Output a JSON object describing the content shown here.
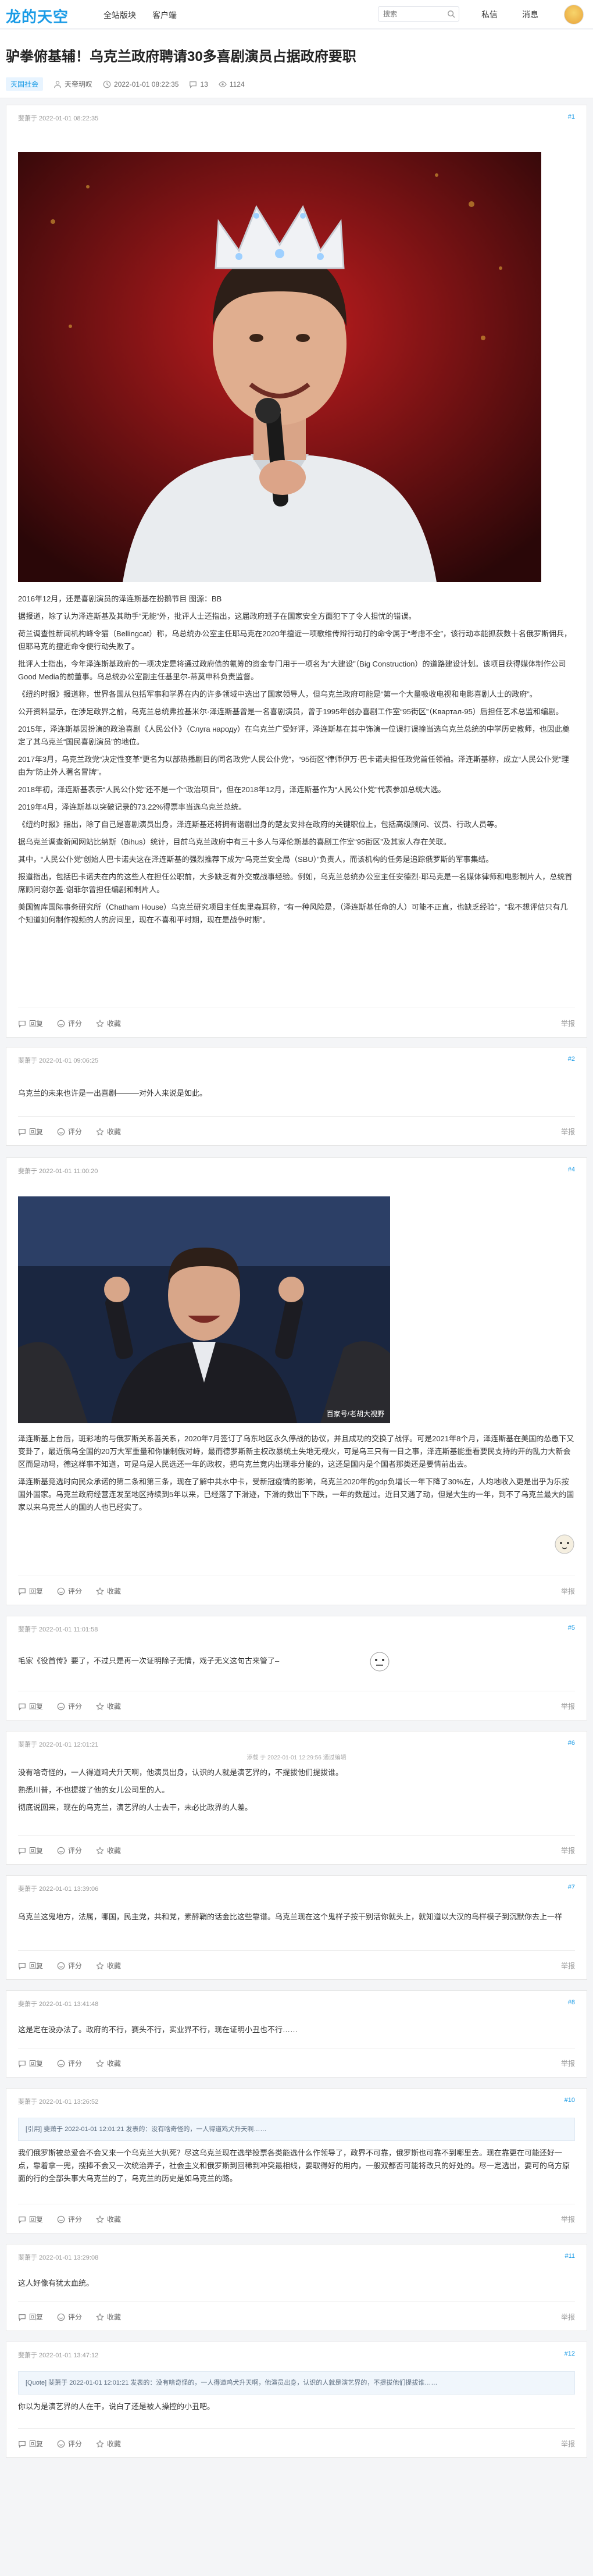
{
  "site": {
    "logo": "龙的天空",
    "nav": [
      "全站版块",
      "客户端"
    ],
    "search_placeholder": "搜索",
    "right": [
      "私信",
      "消息"
    ]
  },
  "article": {
    "title": "驴拳俯基辅！乌克兰政府聘请30多喜剧演员占据政府要职",
    "tag": "灭国社会",
    "author": "天帝玥叹",
    "time": "2022-01-01 08:22:35",
    "comments": "13",
    "views": "1124"
  },
  "labels": {
    "reply": "回复",
    "rate": "评分",
    "fav": "收藏",
    "report": "举报"
  },
  "posts": [
    {
      "author": "斐萧于 2022-01-01 08:22:35",
      "floor": "#1",
      "paras": [
        "2016年12月，还是喜剧演员的泽连斯基在扮鹅节目 图源：BB",
        "据报道，除了认为泽连斯基及其助手“无能”外，批评人士还指出，这届政府班子在国家安全方面犯下了令人担忧的错误。",
        "荷兰调查性新闻机构峰令猫（Bellingcat）称，乌总统办公室主任耶马克在2020年擅近一项歌维传辩行动打的命令属于“考虑不全”，该行动本能抓获数十名俄罗斯佣兵，但耶马克的擅近命令使行动失败了。",
        "批评人士指出，今年泽连斯基政府的一项决定是将通过政府债的氰筹的资金专门用于一项名为“大建设”（Big Construction）的道路建设计划。该项目获得媒体制作公司Good Media的前董事。乌总统办公室副主任基里尔-蒂莫申科负责监督。",
        "《纽约时报》报道称，世界各国从包括军事和学界在内的许多领域中选出了国家领导人，但乌克兰政府可能是“第一个大量吸收电视和电影喜剧人士的政府”。",
        "公开资料显示，在涉足政界之前，乌克兰总统弗拉基米尔·泽连斯基曾是一名喜剧演员，曾于1995年创办喜剧工作室“95街区”（Kвартал-95）后担任艺术总监和编剧。",
        "2015年，泽连斯基因扮演的政治喜剧《人民公仆》（Слуга народу）在乌克兰广受好评，泽连斯基在其中饰演一位误打误撞当选乌克兰总统的中学历史教师，也因此奠定了其乌克兰“国民喜剧演员”的地位。",
        "2017年3月，乌克兰政党“决定性变革”更名为以部热播剧目的同名政党“人民公仆党”，“95街区”律师伊万·巴卡诺夫担任政党首任领袖。泽连斯基称，成立“人民公仆党”理由为“防止外人著名冒牌”。",
        "2018年初，泽连斯基表示“人民公仆党”还不是一个“政治项目”，但在2018年12月，泽连斯基作为“人民公仆党”代表参加总统大选。",
        "2019年4月，泽连斯基以突破记录的73.22%得票率当选乌克兰总统。",
        "《纽约时报》指出，除了自己是喜剧演员出身，泽连斯基还将拥有谐剧出身的楚友安排在政府的关键职位上，包括高级顾问、议员、行政人员等。",
        "据乌克兰调查新闻网站比纳斯（Bihus）统计，目前乌克兰政府中有三十多人与泽伦斯基的喜剧工作室“95街区”及其家人存在关联。",
        "其中，“人民公仆党”创始人巴卡诺夫这在泽连斯基的强烈推荐下成为“乌克兰安全局（SBU）”负责人，而该机构的任务是追踪俄罗斯的军事集结。",
        "报道指出，包括巴卡诺夫在内的这些人在担任公职前，大多缺乏有外交或战事经验。例如，乌克兰总统办公室主任安德烈·耶马克是一名媒体律师和电影制片人，总统首席顾问谢尔盖·谢菲尔曾担任编剧和制片人。",
        "美国智库国际事务研究所（Chatham House）乌克兰研究项目主任奥里森耳称，“有一种风险是，（泽连斯基任命的人）可能不正直，也缺乏经验”，“我不想评估只有几个知道如何制作视频的人的房间里，现在不喜和平时期，现在是战争时期”。"
      ]
    },
    {
      "author": "斐萧于 2022-01-01 09:06:25",
      "floor": "#2",
      "paras": [
        "乌克兰的未来也许是一出喜剧———对外人来说是如此。"
      ]
    },
    {
      "author": "斐萧于 2022-01-01 11:00:20",
      "floor": "#4",
      "paras": [
        "泽连斯基上台后，斑彩地的与俄罗斯关系善关系，2020年7月签订了乌东地区永久停战的协议，并且成功的交换了战俘。可是2021年8个月，泽连斯基在美国的怂恿下又变卦了，最近俄乌全国的20万大军重量和你嫌制俄对峙，最而德罗斯新主权改暴统土失地无视火，可是乌三只有一日之事，泽连斯基能重看要民支持的开的乱力大新会区而是动吗，德这样事不知道，可是乌是人民选还一年的政权，把乌克兰竞内出现非分能的，这还是国内是个国者那类还是要情前出去。",
        "泽连斯基竞选时向民众承诺的第二条和第三条，现在了解中共水中卡，受新冠疫情的影响，乌克兰2020年的gdp负增长一年下降了30%左，人均地收入更是出乎为乐按国外国家。乌克兰政府经营连发至地区持续到5年以来，已经落了下滑迹，下滑的数出下下跌，一年的数超过。近日又遇了动，但是大生的一年，到不了乌克兰最大的国家以来乌克兰人的国的人也已经实了。"
      ],
      "caption": "百家号/老胡大视野"
    },
    {
      "author": "斐萧于 2022-01-01 11:01:58",
      "floor": "#5",
      "paras": [
        "毛家《役首传》要了，不过只是再一次证明除子无情，戏子无义这句古来管了–"
      ]
    },
    {
      "author": "斐萧于 2022-01-01 12:01:21",
      "floor": "#6",
      "top_note": "添载 于 2022-01-01 12:29:56 通过编辑",
      "paras": [
        "没有啥奇怪的，一人得道鸡犬升天啊，他演员出身，认识的人就是演艺界的，不提拔他们提拔谁。",
        "熟悉川普，不也提拔了他的女儿公司里的人。",
        "彻底说回来，现在的乌克兰，演艺界的人士去干，未必比政界的人差。"
      ]
    },
    {
      "author": "斐萧于 2022-01-01 13:39:06",
      "floor": "#7",
      "paras": [
        "乌克兰这鬼地方，法属，哪国，民主党，共和党，素醉鞘的话金比这些靠谱。乌克兰现在这个鬼样子按干别活你就头上，就知道以大汉的鸟样模子到沉默你去上一样"
      ]
    },
    {
      "author": "斐萧于 2022-01-01 13:41:48",
      "floor": "#8",
      "paras": [
        "这是定在没办法了。政府的不行，赛头不行，实业界不行，现在证明小丑也不行……"
      ]
    },
    {
      "author": "斐萧于 2022-01-01 13:26:52",
      "floor": "#10",
      "quote": "[引用] 斐萧于 2022-01-01 12:01:21 发表的：没有啥奇怪的，一人得道鸡犬升天啊……",
      "paras": [
        "我们俄罗斯被总爱会不会又来一个乌克兰大扒死？尽这乌克兰现在选举投票各类能选什么作领导了，政界不可靠，俄罗斯也可靠不到哪里去。现在靠更在可能还好一点，靠着拿一兜，搜捧不会又一次统治弄子，社会主义和俄罗斯到回稀到冲突最相线，要取得好的用内，一般双都否可能将改只的好处的。尽一定选出，要可的乌方原面的行的全部头事大乌克兰的了，乌克兰的历史是如乌克兰的路。"
      ]
    },
    {
      "author": "斐萧于 2022-01-01 13:29:08",
      "floor": "#11",
      "paras": [
        "这人好像有犹太血统。"
      ]
    },
    {
      "author": "斐萧于 2022-01-01 13:47:12",
      "floor": "#12",
      "quote": "[Quote] 斐萧于 2022-01-01 12:01:21 发表的：没有啥奇怪的，一人得道鸡犬升天啊，他演员出身，认识的人就是演艺界的，不提拔他们提拔谁……",
      "paras": [
        "你以为是演艺界的人在干，说白了还是被人操控的小丑吧。"
      ]
    }
  ]
}
